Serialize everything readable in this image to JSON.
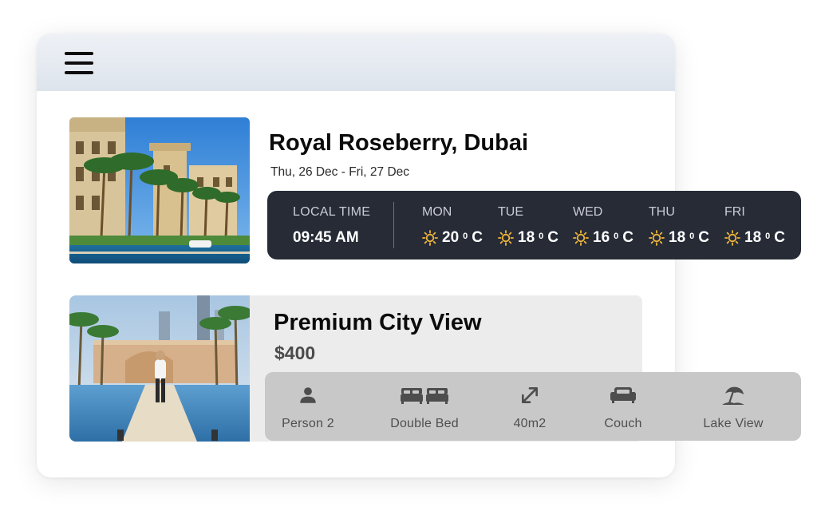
{
  "hotel": {
    "name": "Royal Roseberry, Dubai",
    "dates": "Thu, 26 Dec - Fri, 27 Dec"
  },
  "weather": {
    "local_time_label": "LOCAL TIME",
    "local_time": "09:45 AM",
    "days": [
      {
        "name": "MON",
        "temp": "20",
        "unit": "C",
        "icon": "sun-icon"
      },
      {
        "name": "TUE",
        "temp": "18",
        "unit": "C",
        "icon": "sun-icon"
      },
      {
        "name": "WED",
        "temp": "16",
        "unit": "C",
        "icon": "sun-icon"
      },
      {
        "name": "THU",
        "temp": "18",
        "unit": "C",
        "icon": "sun-icon"
      },
      {
        "name": "FRI",
        "temp": "18",
        "unit": "C",
        "icon": "sun-icon"
      }
    ],
    "icon_color": "#f0b63a"
  },
  "room": {
    "title": "Premium City View",
    "price": "$400",
    "amenities": [
      {
        "label": "Person 2",
        "icon": "person-icon"
      },
      {
        "label": "Double Bed",
        "icon": "double-bed-icon"
      },
      {
        "label": "40m2",
        "icon": "room-size-icon"
      },
      {
        "label": "Couch",
        "icon": "couch-icon"
      },
      {
        "label": "Lake View",
        "icon": "beach-umbrella-icon"
      }
    ]
  },
  "colors": {
    "weather_bar": "#262b36",
    "room_card": "#ececec",
    "amenity_bar": "#c8c8c8"
  }
}
